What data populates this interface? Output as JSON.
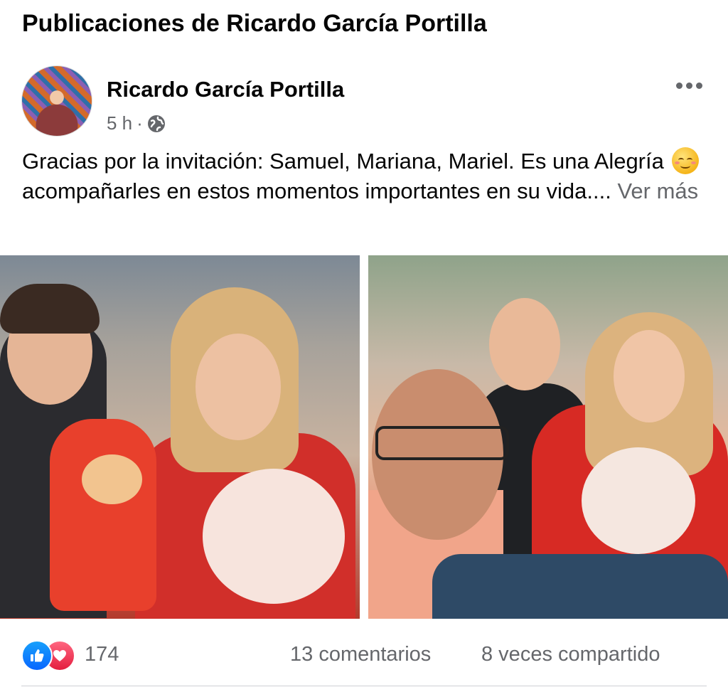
{
  "page": {
    "title": "Publicaciones de Ricardo García Portilla"
  },
  "post": {
    "author": "Ricardo García Portilla",
    "time": "5 h",
    "separator": "·",
    "privacy_icon": "globe-icon",
    "text_part1": "Gracias por la invitación: Samuel, Mariana, Mariel. Es una Alegría",
    "emoji": "relieved-face-emoji",
    "text_part2": "acompañarles en estos momentos importantes en su vida....",
    "see_more": "Ver más",
    "more_icon": "more-horizontal-icon",
    "photos": [
      {
        "name": "photo-1"
      },
      {
        "name": "photo-2"
      }
    ]
  },
  "reactions": {
    "icons": [
      "like-icon",
      "love-icon"
    ],
    "count": "174",
    "comments": "13 comentarios",
    "shares": "8 veces compartido"
  },
  "colors": {
    "like": "#0866ff",
    "love": "#e41e3f",
    "secondary_text": "#65676b",
    "primary_text": "#050505"
  }
}
